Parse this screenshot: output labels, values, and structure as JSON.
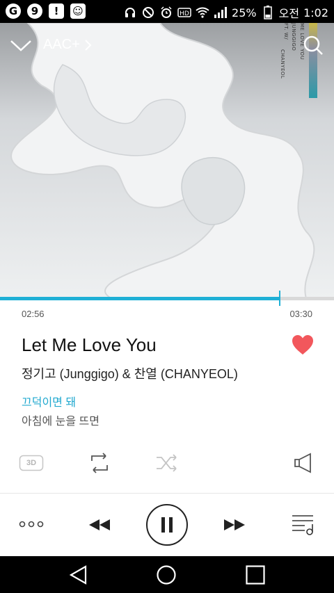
{
  "status_bar": {
    "apps": [
      "G",
      "9",
      "!",
      "☺"
    ],
    "battery_percent": "25%",
    "ampm": "오전",
    "time": "1:02"
  },
  "player_header": {
    "codec_label": "AAC+"
  },
  "album_art_text": {
    "line1": "ME LOVE YOU",
    "line2": "JUNGGIGO",
    "line3": "FT. W/",
    "line4": "CHANYEOL"
  },
  "playback": {
    "elapsed": "02:56",
    "duration": "03:30",
    "progress_fraction": 0.838
  },
  "track": {
    "title": "Let Me Love You",
    "artist": "정기고 (Junggigo) & 찬열 (CHANYEOL)",
    "liked": true
  },
  "lyrics": {
    "current": "끄덕이면 돼",
    "next": "아침에 눈을 뜨면"
  },
  "controls": {
    "three_d_label": "3D"
  },
  "colors": {
    "accent": "#1fb0d6",
    "heart": "#f2575c",
    "lyric_current": "#1fa8cf"
  }
}
